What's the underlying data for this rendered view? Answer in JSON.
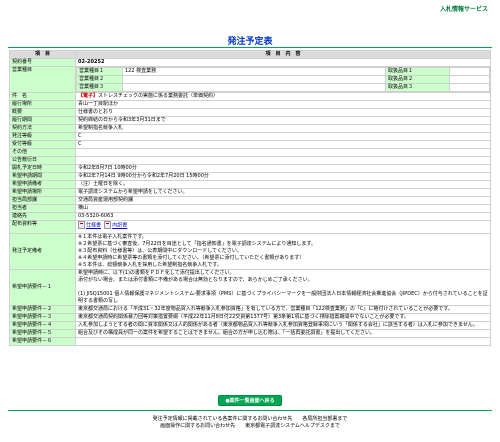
{
  "header": {
    "service_title": "入札情報サービス"
  },
  "page_title": "発注予定表",
  "table_headers": {
    "item": "項　目",
    "content": "項　目　内　容"
  },
  "rows": {
    "contract_no": {
      "label": "契約番号",
      "value": "02-20252"
    },
    "business_type": {
      "label": "営業種目",
      "lines": [
        {
          "label": "営業種目１",
          "value": "122 検査業務",
          "handling": "取扱品目１"
        },
        {
          "label": "営業種目２",
          "value": "",
          "handling": "取扱品目２"
        },
        {
          "label": "営業種目３",
          "value": "",
          "handling": "取扱品目３"
        }
      ]
    },
    "subject": {
      "label": "件　名",
      "badge": "【電子】",
      "value": "ストレスチェックの実施に係る業務委託（単価契約）"
    },
    "place": {
      "label": "履行場所",
      "value": "青山一丁目駅ほか"
    },
    "summary": {
      "label": "概要",
      "value": "仕様書のとおり"
    },
    "period": {
      "label": "履行期間",
      "value": "契約締結の日から令和3年3月31日まで"
    },
    "method": {
      "label": "契約方法",
      "value": "希望制指名競争入札"
    },
    "order_grade": {
      "label": "発注等級",
      "value": "C"
    },
    "accept_grade": {
      "label": "受付等級",
      "value": "C"
    },
    "other": {
      "label": "その他",
      "value": ""
    },
    "announce_date": {
      "label": "公告敷衍日",
      "value": ""
    },
    "open_date": {
      "label": "開札予定日時",
      "value": "令和2年8月7日 10時00分"
    },
    "apply_period": {
      "label": "希望申請期間",
      "value": "令和2年7月14日 9時00分から令和2年7月20日 15時00分"
    },
    "apply_note": {
      "label": "希望申請備考",
      "value": "（注）土曜日を除く。"
    },
    "apply_place": {
      "label": "希望申請場所",
      "value": "電子調達システムから希望申請をしてください。"
    },
    "dept": {
      "label": "担当局部課",
      "value": "交通局資産運用部契約課"
    },
    "person": {
      "label": "担当者",
      "value": "横山"
    },
    "contact": {
      "label": "連絡先",
      "value": "03-5320-6063"
    },
    "docs": {
      "label": "配布資料等",
      "file1": "仕様書",
      "file2": "内訳書"
    },
    "schedule_notes": {
      "label": "発注予定備考",
      "lines": [
        "※１本件は電子入札案件です。",
        "※２希望票に基づく審査後、7月22日を目途として「指名通知書」を電子調達システムにより通知します。",
        "※３配布資料（仕様書等）は、公表期間中にダウンロードしてください。",
        "※４希望申請時に希望票等の書類を添付してください。（希望票に添付していただく書類があります）",
        "※５本件は、総額競争入札を採用した希望制指名競争入札です。"
      ]
    },
    "req1": {
      "label": "希望申請要件－１",
      "lines": [
        "希望申請時に、以下(1)の書類をＰＤＦ化して添付提出してください。",
        "添付がない場合、または添付書類に不備がある場合は無効となりますので、あらかじめご了承ください。",
        "",
        "(1) JISQ15001 個人情報保護マネジメントシステム-要求事項（PMS）に基づくプライバシーマークを一般財団法人日本情報経済社会推進協会（JIPDEC）から付与されていることを証明する書類の写し"
      ]
    },
    "req2": {
      "label": "希望申請要件－２",
      "value": "東京都交通局における「平成31・32年度物品買入れ等競争入札参加資格」を有している方で、営業種目「122検査業務」の「C」に格付けされていることが必要です。"
    },
    "req3": {
      "label": "希望申請要件－３",
      "value": "東京都交通局契約関係暴力団等対策措置要綱（平成22年11月8日付22交資第1377号）第3条第1項に基づく排除措置期間中でないことが必要です。"
    },
    "req4": {
      "label": "希望申請要件－４",
      "value": "入札参加しようとする者の間に資本関係又は人的関係がある者（東京都物品買入れ等競争入札参加資格登録事項にいう「関係する会社」に該当する者）は入札に参加できません。"
    },
    "req5": {
      "label": "希望申請要件－５",
      "value": "組合及びその構成員が同一の案件を希望することはできません。組合の方が申し込む際は、「一括再委託調書」を提出してください。"
    },
    "req6": {
      "label": "希望申請要件－６",
      "value": ""
    }
  },
  "back_button": "●案件一覧画面へ戻る",
  "footer": {
    "line1": "発注予定情報に掲載されている各案件に関するお問い合わせ先　　各局所担当部署まで",
    "line2": "画面操作に関するお問い合わせ先　　東京都電子調達システムヘルプデスクまで"
  }
}
